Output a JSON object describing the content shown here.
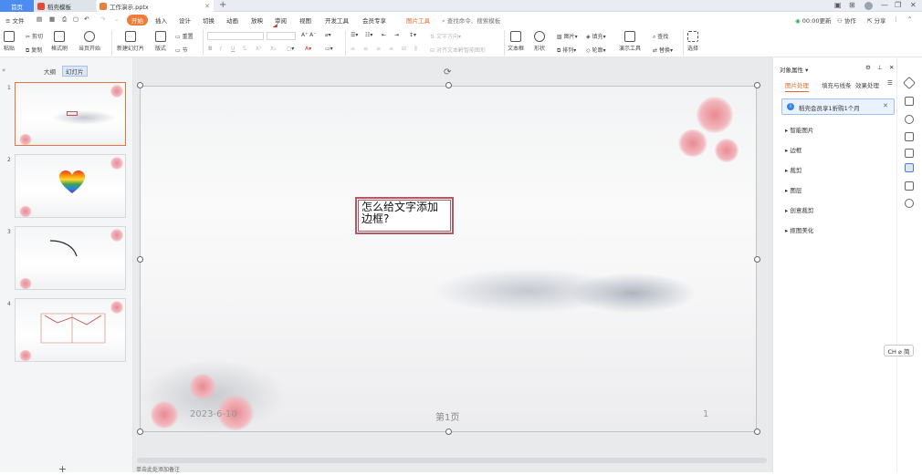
{
  "titlebar": {
    "tabs": [
      {
        "label": "首页"
      },
      {
        "label": "稻壳模板"
      },
      {
        "label": "工作演示.pptx"
      }
    ],
    "new_tab": "+"
  },
  "menubar": {
    "file": "≡ 文件",
    "items": [
      "开始",
      "插入",
      "设计",
      "切换",
      "动画",
      "放映",
      "审阅",
      "视图",
      "开发工具",
      "会员专享",
      "图片工具"
    ],
    "search_placeholder": "查找命令、搜索模板",
    "right": [
      "00:00更新",
      "协作",
      "分享"
    ]
  },
  "ribbon": {
    "paste": "粘贴",
    "cut": "剪切",
    "copy": "复制",
    "format_painter": "格式刷",
    "play_from_current": "当页开始",
    "new_slide": "新建幻灯片",
    "layout": "版式",
    "reset": "重置",
    "section": "节",
    "text_direction": "文字方向",
    "align_text": "对齐文本",
    "smartart": "转智能图形",
    "textbox": "文本框",
    "shape": "形状",
    "picture": "图片",
    "fill": "填充",
    "arrange": "排列",
    "outline": "轮廓",
    "slideshow_tools": "演示工具",
    "find": "查找",
    "replace": "替换",
    "select": "选择"
  },
  "leftpanel": {
    "tabs": [
      "大纲",
      "幻灯片"
    ],
    "slide_numbers": [
      "1",
      "2",
      "3",
      "4"
    ],
    "add": "+"
  },
  "slide": {
    "textbox": "怎么给文字添加边框?",
    "date": "2023-6-10",
    "page_label": "第1页",
    "page_number": "1"
  },
  "rightpanel": {
    "title": "对象属性",
    "tabs": [
      "图片处理",
      "填充与线条",
      "效果处理"
    ],
    "notice": "稻壳会员享1折购1个月",
    "sections": [
      "智能图片",
      "边框",
      "裁剪",
      "图层",
      "创意裁剪",
      "抠图美化"
    ]
  },
  "ime": "CH ⌀ 简",
  "statusbar": {
    "note": "单击此处添加备注"
  },
  "colors": {
    "accent": "#e8672a",
    "tab_blue": "#4d8bf0",
    "textbox_border": "#b65862",
    "annotation_arrow": "#d0312d"
  }
}
